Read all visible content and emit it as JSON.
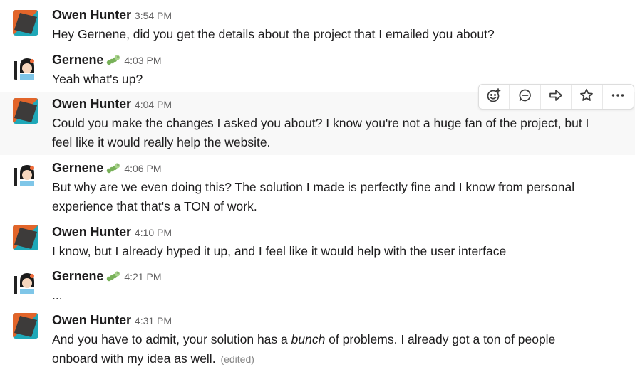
{
  "messages": [
    {
      "author": "Owen Hunter",
      "time": "3:54 PM",
      "lines": [
        "Hey Gernene, did you get the details about the project that I emailed you about?"
      ],
      "avatar": "owen-logo-avatar"
    },
    {
      "author": "Gernene",
      "status_emoji": "caterpillar-icon",
      "time": "4:03 PM",
      "lines": [
        "Yeah what's up?"
      ],
      "avatar": "gernene-avatar"
    },
    {
      "author": "Owen Hunter",
      "time": "4:04 PM",
      "lines": [
        "Could you make the changes I asked you about? I know you're not a huge fan of the project, but I",
        "feel like it would really help the website."
      ],
      "avatar": "owen-logo-avatar"
    },
    {
      "author": "Gernene",
      "status_emoji": "caterpillar-icon",
      "time": "4:06 PM",
      "lines": [
        "But why are we even doing this? The solution I made is perfectly fine and I know from personal",
        "experience that that's a TON of work."
      ],
      "avatar": "gernene-avatar"
    },
    {
      "author": "Owen Hunter",
      "time": "4:10 PM",
      "lines": [
        "I know, but I already hyped it up, and I feel like it would help with the user interface"
      ],
      "avatar": "owen-logo-avatar"
    },
    {
      "author": "Gernene",
      "status_emoji": "caterpillar-icon",
      "time": "4:21 PM",
      "lines": [
        "..."
      ],
      "avatar": "gernene-avatar"
    },
    {
      "author": "Owen Hunter",
      "time": "4:31 PM",
      "line1_before": "And you have to admit, your solution has a ",
      "line1_em": "bunch",
      "line1_after": " of problems. I already got a ton of people",
      "line2": "onboard with my idea as well.",
      "edited": "(edited)",
      "avatar": "owen-logo-avatar"
    }
  ],
  "toolbar": {
    "actions": [
      "add-reaction-icon",
      "reply-in-thread-icon",
      "share-message-icon",
      "save-star-icon",
      "more-actions-icon"
    ]
  },
  "colors": {
    "owen_orange": "#e2652a",
    "owen_teal": "#1fa8b8",
    "owen_dark": "#3d3b3a",
    "gernene_shirt": "#7fc6e8",
    "hover_bg": "#f8f8f8",
    "time_gray": "#616061"
  }
}
